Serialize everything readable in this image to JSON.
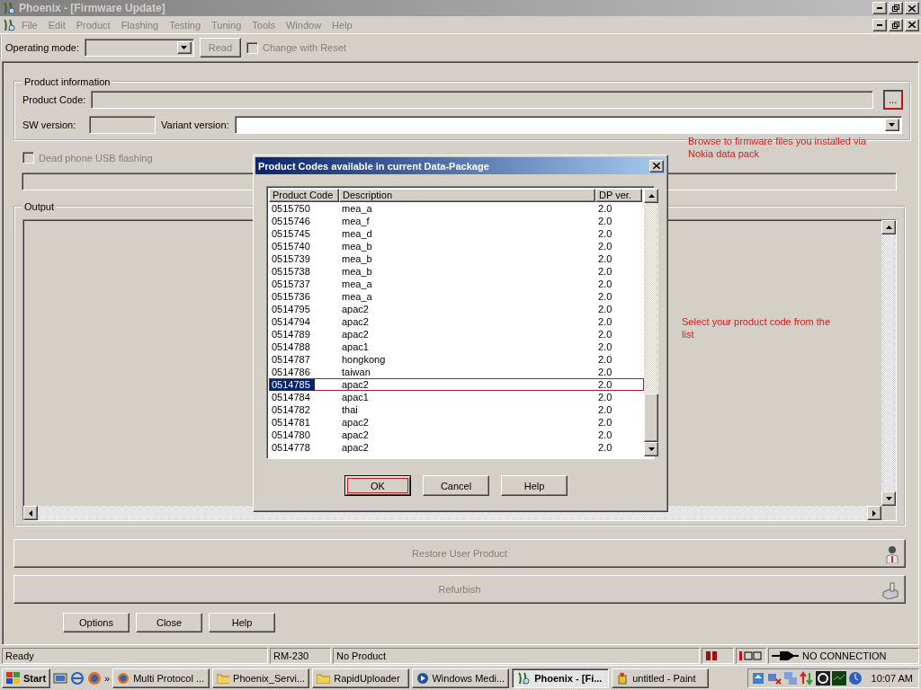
{
  "window": {
    "title": "Phoenix - [Firmware Update]"
  },
  "menu": [
    "File",
    "Edit",
    "Product",
    "Flashing",
    "Testing",
    "Tuning",
    "Tools",
    "Window",
    "Help"
  ],
  "toolbar": {
    "operating_mode_label": "Operating mode:",
    "read_button": {
      "label": "Read",
      "disabled": true
    },
    "change_with_reset": {
      "label": "Change with Reset",
      "checked": false,
      "disabled": true
    }
  },
  "product_information": {
    "title": "Product information",
    "product_code_label": "Product Code:",
    "browse_button": "...",
    "sw_version_label": "SW version:",
    "variant_version_label": "Variant version:"
  },
  "dead_phone": {
    "label": "Dead phone USB flashing",
    "checked": false,
    "disabled": true
  },
  "output": {
    "title": "Output"
  },
  "action_buttons": [
    {
      "label": "Restore User Product",
      "kind": "person",
      "disabled": true
    },
    {
      "label": "Refurbish",
      "kind": "machine",
      "disabled": true
    }
  ],
  "bottom_buttons": [
    "Options",
    "Close",
    "Help"
  ],
  "annotations": [
    "Browse to firmware files you installed via Nokia data pack",
    "Select your product code from the list"
  ],
  "status_bar": {
    "ready": "Ready",
    "model": "RM-230",
    "product": "No Product",
    "connection": "NO CONNECTION"
  },
  "taskbar": {
    "start": "Start",
    "overflow": "»",
    "clock": "10:07 AM",
    "tasks": [
      {
        "label": "Multi Protocol ...",
        "kind": "browser",
        "selected": false
      },
      {
        "label": "Phoenix_Servi...",
        "kind": "folder",
        "selected": false
      },
      {
        "label": "RapidUploader",
        "kind": "folder",
        "selected": false
      },
      {
        "label": "Windows Medi...",
        "kind": "media",
        "selected": false
      },
      {
        "label": "Phoenix - [Fi...",
        "kind": "phoenix",
        "selected": true
      },
      {
        "label": "untitled - Paint",
        "kind": "paint",
        "selected": false
      }
    ]
  },
  "dialog": {
    "title": "Product Codes available in current Data-Package",
    "columns": [
      "Product Code",
      "Description",
      "DP ver."
    ],
    "rows": [
      {
        "code": "0515750",
        "description": "mea_a",
        "dp_ver": "2.0",
        "selected": false
      },
      {
        "code": "0515746",
        "description": "mea_f",
        "dp_ver": "2.0",
        "selected": false
      },
      {
        "code": "0515745",
        "description": "mea_d",
        "dp_ver": "2.0",
        "selected": false
      },
      {
        "code": "0515740",
        "description": "mea_b",
        "dp_ver": "2.0",
        "selected": false
      },
      {
        "code": "0515739",
        "description": "mea_b",
        "dp_ver": "2.0",
        "selected": false
      },
      {
        "code": "0515738",
        "description": "mea_b",
        "dp_ver": "2.0",
        "selected": false
      },
      {
        "code": "0515737",
        "description": "mea_a",
        "dp_ver": "2.0",
        "selected": false
      },
      {
        "code": "0515736",
        "description": "mea_a",
        "dp_ver": "2.0",
        "selected": false
      },
      {
        "code": "0514795",
        "description": "apac2",
        "dp_ver": "2.0",
        "selected": false
      },
      {
        "code": "0514794",
        "description": "apac2",
        "dp_ver": "2.0",
        "selected": false
      },
      {
        "code": "0514789",
        "description": "apac2",
        "dp_ver": "2.0",
        "selected": false
      },
      {
        "code": "0514788",
        "description": "apac1",
        "dp_ver": "2.0",
        "selected": false
      },
      {
        "code": "0514787",
        "description": "hongkong",
        "dp_ver": "2.0",
        "selected": false
      },
      {
        "code": "0514786",
        "description": "taiwan",
        "dp_ver": "2.0",
        "selected": false
      },
      {
        "code": "0514785",
        "description": "apac2",
        "dp_ver": "2.0",
        "selected": true
      },
      {
        "code": "0514784",
        "description": "apac1",
        "dp_ver": "2.0",
        "selected": false
      },
      {
        "code": "0514782",
        "description": "thai",
        "dp_ver": "2.0",
        "selected": false
      },
      {
        "code": "0514781",
        "description": "apac2",
        "dp_ver": "2.0",
        "selected": false
      },
      {
        "code": "0514780",
        "description": "apac2",
        "dp_ver": "2.0",
        "selected": false
      },
      {
        "code": "0514778",
        "description": "apac2",
        "dp_ver": "2.0",
        "selected": false
      }
    ],
    "buttons": [
      "OK",
      "Cancel",
      "Help"
    ]
  }
}
